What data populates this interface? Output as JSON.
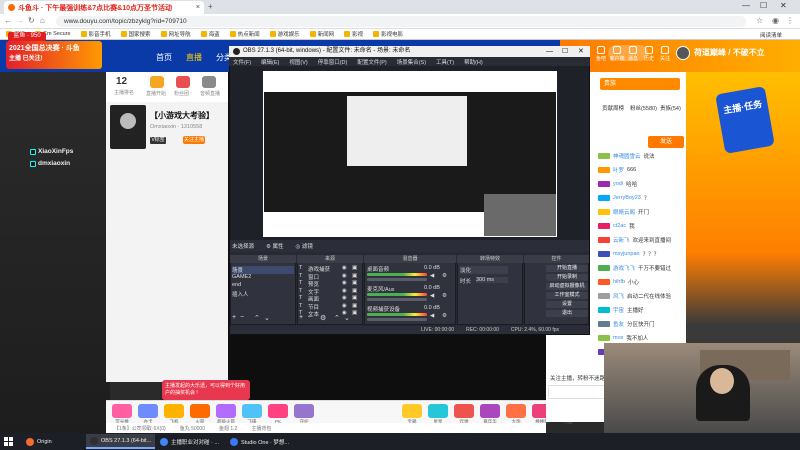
{
  "browser": {
    "tab_title": "斗鱼斗 · 下午最强训练&7点比赛&10点万圣节活动",
    "url": "www.douyu.com/topic/zbzyklg?rid=709710",
    "bookmarks": [
      "应用",
      "Cm Secure",
      "影音手机",
      "国家搜索",
      "网址导航",
      "海盗",
      "热点新闻",
      "游戏娱乐",
      "新闻网",
      "影视",
      "影视电影"
    ],
    "reading_list": "阅读清单"
  },
  "site": {
    "badge": "鲨鱼 · 950",
    "logo_text": "2021全国总决赛 · 斗鱼",
    "logo_sub": "主播 已关注!",
    "nav": [
      {
        "label": "首页",
        "active": false
      },
      {
        "label": "直播",
        "active": true
      },
      {
        "label": "分类",
        "active": false
      }
    ],
    "header_icons": [
      "鱼吧",
      "客户端",
      "消息",
      "历史",
      "关注"
    ],
    "slogan": "荷道巅峰 / 不破不立",
    "room_number": "12",
    "room_number_label": "主播排名",
    "room_icons": [
      "直播开始",
      "粉丝团",
      "音频直播"
    ],
    "anchor_title": "【小游戏大考验】",
    "anchor_sub": "Omxiaoxin · 1310558",
    "anchor_tag": "V标签",
    "follow_label": "关注主播",
    "social": [
      {
        "name": "tiktok",
        "label": "XiaoXinFps"
      },
      {
        "name": "douyin",
        "label": "dmxiaoxin"
      }
    ],
    "promo_bubble": "主播发起的大乐透，可以得到个好用户的抽奖机会 !",
    "gifts": [
      "荧光棒",
      "办卡",
      "飞机",
      "火箭",
      "超级火箭",
      "飞碟",
      "PK",
      "守护",
      "宝箱",
      "星星",
      "炸弹",
      "嘉年华",
      "大炮",
      "棒棒糖",
      "礼盒"
    ],
    "bottom_info": [
      "【1条】公司领取·6X(0)",
      "鱼丸 50000",
      "鱼翅 1.2",
      "主播背包"
    ],
    "right_badge": "主播·任务"
  },
  "chat": {
    "top_button": "贵族",
    "tabs": [
      "贡献周榜",
      "粉丝(5580)",
      "贵族(54)"
    ],
    "send_button": "发送",
    "messages": [
      {
        "name": "神魂圆雪云",
        "text": "说法",
        "color": "#8bc34a"
      },
      {
        "name": "叶罗",
        "text": "666",
        "color": "#ff9800"
      },
      {
        "name": "yodi",
        "text": "哈哈",
        "color": "#9c27b0"
      },
      {
        "name": "JerryBoy23",
        "text": "？",
        "color": "#03a9f4"
      },
      {
        "name": "眼睛云阁",
        "text": "开门",
        "color": "#ffc107"
      },
      {
        "name": "ct2ac",
        "text": "我",
        "color": "#e91e63"
      },
      {
        "name": "云新飞",
        "text": "欢迎来到直播间",
        "color": "#f44336"
      },
      {
        "name": "msyjunpan",
        "text": "？？？",
        "color": "#3f51b5"
      },
      {
        "name": "游戏飞飞",
        "text": "千万不要错过",
        "color": "#4caf50"
      },
      {
        "name": "hihfb",
        "text": "小心",
        "color": "#ff5722"
      },
      {
        "name": "风飞",
        "text": "启动二代在线体验",
        "color": "#9e9e9e"
      },
      {
        "name": "宇宙",
        "text": "主播好",
        "color": "#00bcd4"
      },
      {
        "name": "鱼友",
        "text": "分区快开门",
        "color": "#607d8b"
      },
      {
        "name": "mox",
        "text": "我不加人",
        "color": "#8bc34a"
      },
      {
        "name": "苏伊",
        "text": "你头像好帅",
        "color": "#673ab7"
      }
    ],
    "bottom_hint": "关注主播，转粉不迷路"
  },
  "obs": {
    "title": "OBS 27.1.3 (64-bit, windows) - 配置文件: 未命名 - 场景: 未命名",
    "menu": [
      "文件(F)",
      "编辑(E)",
      "视图(V)",
      "停靠窗口(D)",
      "配置文件(P)",
      "场景集合(S)",
      "工具(T)",
      "帮助(H)"
    ],
    "no_source": "未选择源",
    "props_label": "属性",
    "filters_label": "滤镜",
    "docks": [
      "场景",
      "来源",
      "混音器",
      "转场特效",
      "控件"
    ],
    "scenes": [
      "场景",
      "GAME2",
      "end",
      "插入人"
    ],
    "sources": [
      "游戏捕获",
      "窗口",
      "预览",
      "文字",
      "画面",
      "节目",
      "文本"
    ],
    "mixer": [
      {
        "label": "桌面音频",
        "db": "0.0 dB"
      },
      {
        "label": "麦克风/Aux",
        "db": "0.0 dB"
      },
      {
        "label": "视频捕获设备",
        "db": "0.0 dB"
      }
    ],
    "transition": {
      "type": "淡化",
      "duration_label": "时长",
      "duration": "300 ms"
    },
    "controls": [
      "开始直播",
      "开始录制",
      "启动虚拟摄像机",
      "工作室模式",
      "设置",
      "退出"
    ],
    "status": [
      "LIVE: 00:00:00",
      "REC: 00:00:00",
      "CPU: 2.4%, 60.00 fps"
    ]
  },
  "taskbar": {
    "items": [
      {
        "label": "Origin",
        "color": "#f56c2d",
        "active": false
      },
      {
        "label": "OBS 27.1.3 (64-bit...",
        "color": "#302e31",
        "active": true
      },
      {
        "label": "主播职业对对碰 · ...",
        "color": "#4285f4",
        "active": false
      },
      {
        "label": "Studio One · 梦想...",
        "color": "#3a78f2",
        "active": false
      }
    ]
  },
  "colors": {
    "header_blue": "#0a3aa8",
    "accent_orange": "#ff7800",
    "obs_bg": "#2b2e38",
    "brand_red": "#e21f2c"
  }
}
